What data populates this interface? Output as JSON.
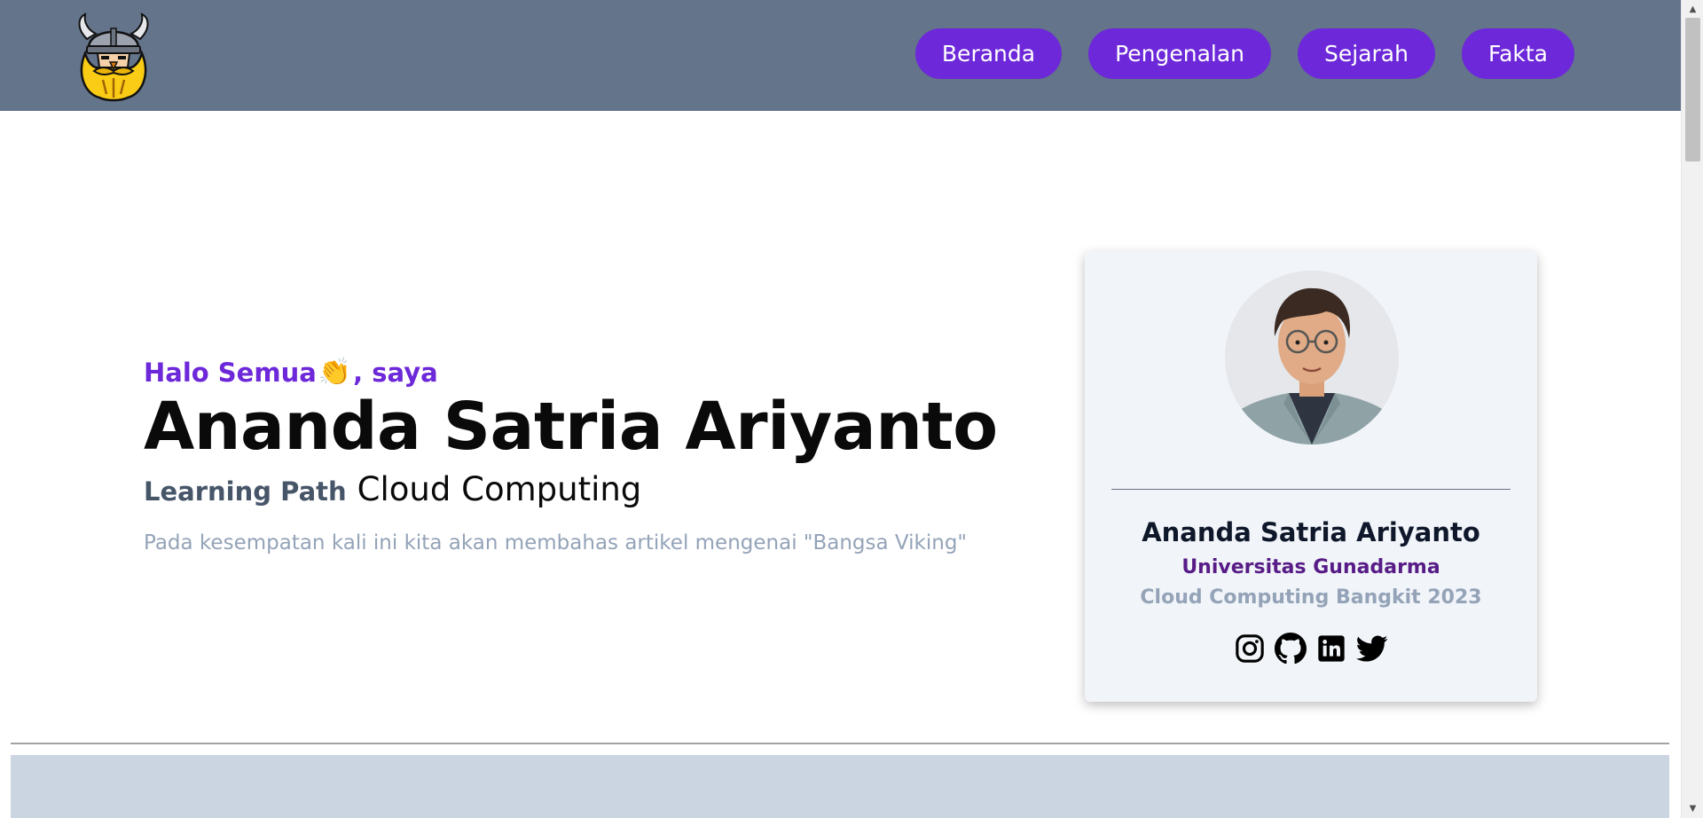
{
  "header": {
    "logo_icon": "viking-logo-icon",
    "nav": [
      {
        "label": "Beranda"
      },
      {
        "label": "Pengenalan"
      },
      {
        "label": "Sejarah"
      },
      {
        "label": "Fakta"
      }
    ]
  },
  "hero": {
    "greeting_before": "Halo Semua",
    "greeting_emoji": "👏",
    "greeting_after": ", saya",
    "name": "Ananda Satria Ariyanto",
    "path_label": "Learning Path",
    "path_value": "Cloud Computing",
    "subtitle": "Pada kesempatan kali ini kita akan membahas artikel mengenai \"Bangsa Viking\""
  },
  "card": {
    "avatar_icon": "profile-photo",
    "name": "Ananda Satria Ariyanto",
    "university": "Universitas Gunadarma",
    "program": "Cloud Computing Bangkit 2023",
    "socials": [
      "instagram-icon",
      "github-icon",
      "linkedin-icon",
      "twitter-icon"
    ]
  },
  "colors": {
    "header_bg": "#64748b",
    "accent": "#6d28d9",
    "card_bg": "#f1f5f9",
    "next_section_bg": "#cbd5e1"
  }
}
